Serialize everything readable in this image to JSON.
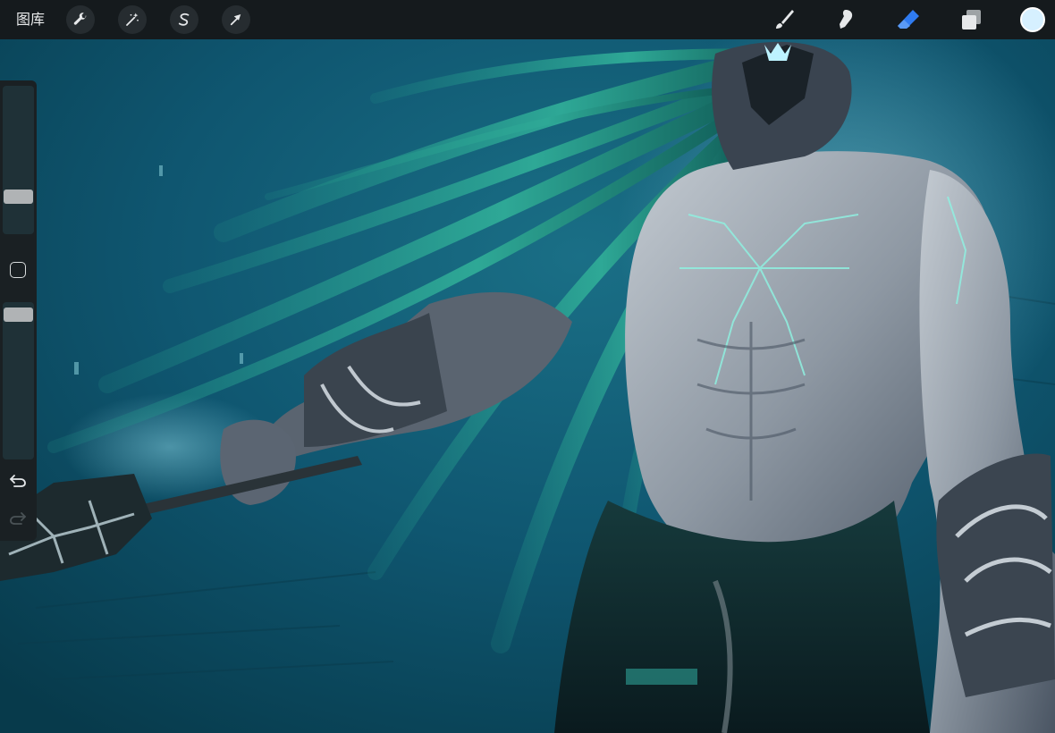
{
  "toolbar": {
    "gallery_label": "图库",
    "left_tools": [
      {
        "icon": "wrench-icon",
        "name": "actions"
      },
      {
        "icon": "magic-wand-icon",
        "name": "adjustments"
      },
      {
        "icon": "selection-s-icon",
        "name": "selection"
      },
      {
        "icon": "arrow-cursor-icon",
        "name": "transform"
      }
    ],
    "right_tools": [
      {
        "icon": "brush-icon",
        "name": "paint",
        "active": false
      },
      {
        "icon": "smudge-icon",
        "name": "smudge",
        "active": false
      },
      {
        "icon": "eraser-icon",
        "name": "erase",
        "active": true
      },
      {
        "icon": "layers-icon",
        "name": "layers",
        "active": false
      }
    ],
    "current_color": "#d6f0ff",
    "active_tool_color": "#2f7bf0"
  },
  "sidebar": {
    "brush_size_level": 0.22,
    "brush_opacity_level": 0.97,
    "modify_icon": "square-icon",
    "undo_icon": "undo-arrow-icon",
    "redo_icon": "redo-arrow-icon",
    "redo_enabled": false
  },
  "canvas": {
    "background_color": "#0b4a5e",
    "artwork": "digital-painting-figure"
  }
}
